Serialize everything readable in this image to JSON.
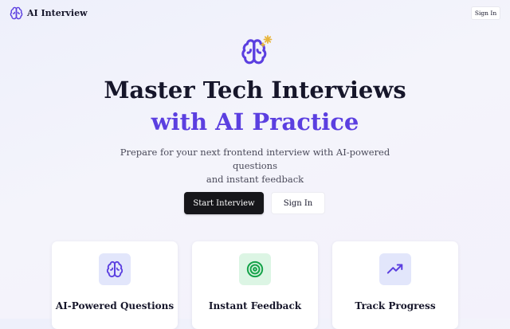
{
  "nav": {
    "brand": "AI Interview",
    "brand_icon": "brain-icon",
    "signin_label": "Sign In"
  },
  "hero": {
    "icon": "brain-sparkle-icon",
    "title_line1": "Master Tech Interviews",
    "title_line2": "with AI Practice",
    "subtitle_line1": "Prepare for your next frontend interview with AI-powered questions",
    "subtitle_line2": "and instant feedback",
    "start_label": "Start Interview",
    "signin_label": "Sign In"
  },
  "features": [
    {
      "title": "AI-Powered Questions",
      "icon": "brain-icon",
      "icon_color": "#5b3fe0",
      "icon_bg": "#e2e6fb"
    },
    {
      "title": "Instant Feedback",
      "icon": "target-icon",
      "icon_color": "#16a34a",
      "icon_bg": "#dcf5e4"
    },
    {
      "title": "Track Progress",
      "icon": "trending-up-icon",
      "icon_color": "#5b3fe0",
      "icon_bg": "#e2e6fb"
    }
  ],
  "colors": {
    "accent": "#5b3fe0",
    "sparkle": "#e8b53c",
    "primary_button": "#16161a"
  }
}
